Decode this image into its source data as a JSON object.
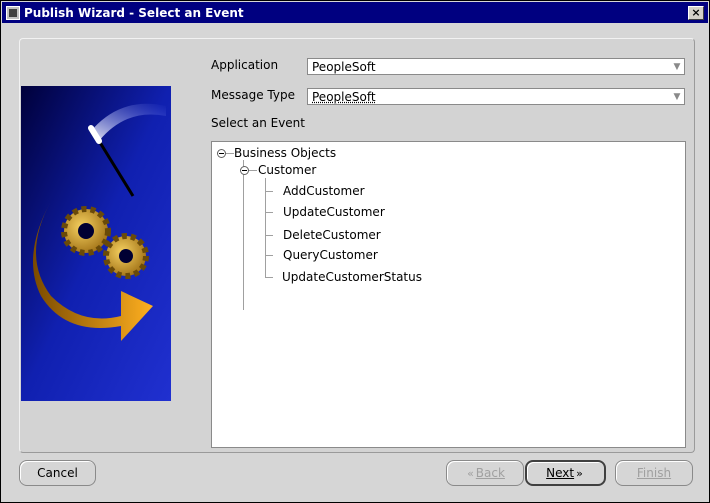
{
  "window": {
    "title": "Publish Wizard - Select an Event",
    "close_glyph": "×"
  },
  "form": {
    "application_label": "Application",
    "application_value": "PeopleSoft",
    "message_type_label": "Message Type",
    "message_type_value": "PeopleSoft",
    "select_event_label": "Select an Event"
  },
  "tree": {
    "root": "Business Objects",
    "child": "Customer",
    "leaves": [
      "AddCustomer",
      "UpdateCustomer",
      "DeleteCustomer",
      "QueryCustomer",
      "UpdateCustomerStatus"
    ]
  },
  "buttons": {
    "cancel": "Cancel",
    "back": "Back",
    "next": "Next",
    "finish": "Finish"
  },
  "icons": {
    "collapse": "collapse-node-icon",
    "dropdown": "dropdown-arrow-icon",
    "back_chevron": "«",
    "next_chevron": "»"
  },
  "colors": {
    "titlebar": "#000080",
    "background": "#d6d6d6"
  }
}
